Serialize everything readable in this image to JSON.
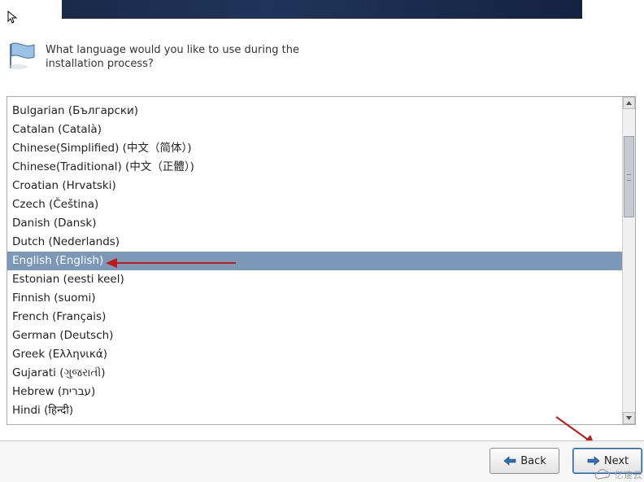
{
  "prompt": "What language would you like to use during the installation process?",
  "languages": [
    "Bulgarian (Български)",
    "Catalan (Català)",
    "Chinese(Simplified) (中文（简体）)",
    "Chinese(Traditional) (中文（正體）)",
    "Croatian (Hrvatski)",
    "Czech (Čeština)",
    "Danish (Dansk)",
    "Dutch (Nederlands)",
    "English (English)",
    "Estonian (eesti keel)",
    "Finnish (suomi)",
    "French (Français)",
    "German (Deutsch)",
    "Greek (Ελληνικά)",
    "Gujarati (ગુજરાતી)",
    "Hebrew (עברית)",
    "Hindi (हिन्दी)"
  ],
  "selected_index": 8,
  "buttons": {
    "back": "Back",
    "next": "Next"
  },
  "watermark": "亿速云",
  "colors": {
    "selection_bg": "#7b98b9",
    "annotation": "#c21818",
    "btn_arrow": "#2e6fb5"
  }
}
